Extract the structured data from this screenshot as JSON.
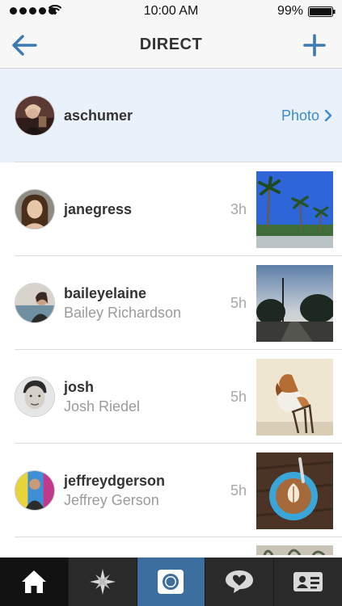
{
  "status_bar": {
    "time": "10:00 AM",
    "battery_percent": "99%",
    "signal_bars": 5
  },
  "nav": {
    "title": "DIRECT",
    "back_icon": "back-arrow-icon",
    "new_icon": "plus-icon"
  },
  "threads": [
    {
      "username": "aschumer",
      "fullname": "",
      "time": "",
      "action_label": "Photo",
      "highlighted": true
    },
    {
      "username": "janegress",
      "fullname": "",
      "time": "3h"
    },
    {
      "username": "baileyelaine",
      "fullname": "Bailey Richardson",
      "time": "5h"
    },
    {
      "username": "josh",
      "fullname": "Josh Riedel",
      "time": "5h"
    },
    {
      "username": "jeffreydgerson",
      "fullname": "Jeffrey Gerson",
      "time": "5h"
    }
  ],
  "tab_bar": {
    "tabs": [
      "home-icon",
      "explore-icon",
      "camera-icon",
      "activity-icon",
      "profile-icon"
    ],
    "active": "home-icon"
  },
  "colors": {
    "accent": "#3d8bcd",
    "highlight_row": "#e9f1fa",
    "tab_bar": "#2a2a2a",
    "camera_tab": "#3c6f9f"
  }
}
